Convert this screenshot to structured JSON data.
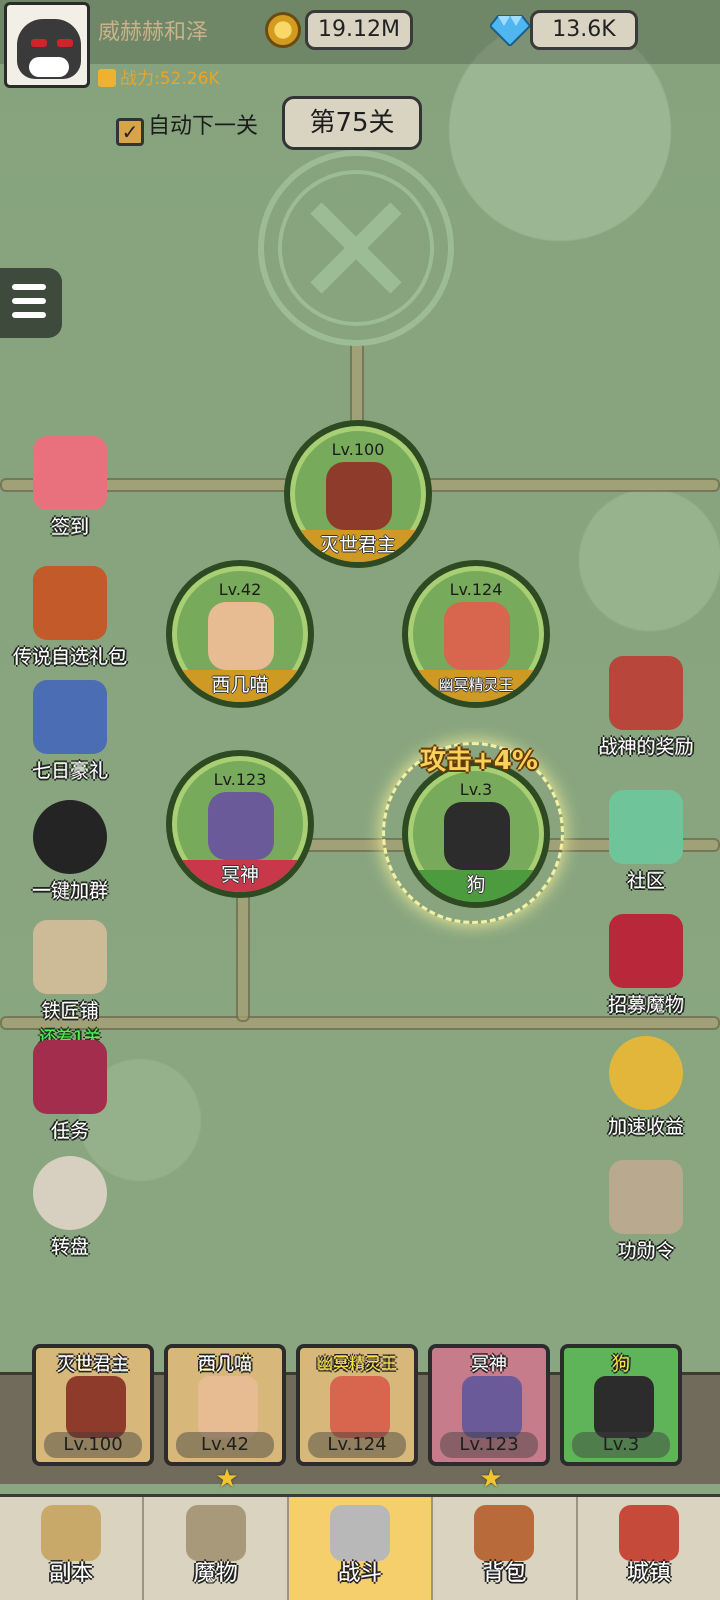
{
  "header": {
    "player_name": "威赫赫和泽",
    "power_label": "战力:52.26K",
    "coins": "19.12M",
    "gems": "13.6K"
  },
  "stage_controls": {
    "auto_next_label": "自动下一关",
    "auto_next_checked": true,
    "stage_label": "第75关"
  },
  "left_menu": [
    {
      "label": "签到",
      "sub": ""
    },
    {
      "label": "传说自选礼包",
      "sub": ""
    },
    {
      "label": "七日豪礼",
      "sub": ""
    },
    {
      "label": "一键加群",
      "sub": ""
    },
    {
      "label": "铁匠铺",
      "sub": "还差1关"
    },
    {
      "label": "任务",
      "sub": ""
    },
    {
      "label": "转盘",
      "sub": ""
    }
  ],
  "right_menu": [
    {
      "label": "战神的奖励"
    },
    {
      "label": "社区"
    },
    {
      "label": "招募魔物"
    },
    {
      "label": "加速收益"
    },
    {
      "label": "功勋令"
    }
  ],
  "heroes_on_field": [
    {
      "name": "灭世君主",
      "level": "Lv.100",
      "plate": "gold"
    },
    {
      "name": "西几喵",
      "level": "Lv.42",
      "plate": "gold"
    },
    {
      "name": "幽冥精灵王",
      "level": "Lv.124",
      "plate": "gold"
    },
    {
      "name": "冥神",
      "level": "Lv.123",
      "plate": "red"
    },
    {
      "name": "狗",
      "level": "Lv.3",
      "plate": "green"
    }
  ],
  "buff_text": "攻击+4%",
  "team": [
    {
      "name": "灭世君主",
      "level": "Lv.100",
      "starred": false
    },
    {
      "name": "西几喵",
      "level": "Lv.42",
      "starred": true
    },
    {
      "name": "幽冥精灵王",
      "level": "Lv.124",
      "starred": false
    },
    {
      "name": "冥神",
      "level": "Lv.123",
      "starred": true
    },
    {
      "name": "狗",
      "level": "Lv.3",
      "starred": false
    }
  ],
  "bottom_nav": [
    {
      "label": "副本",
      "active": false
    },
    {
      "label": "魔物",
      "active": false
    },
    {
      "label": "战斗",
      "active": true
    },
    {
      "label": "背包",
      "active": false
    },
    {
      "label": "城镇",
      "active": false
    }
  ],
  "colors": {
    "map_green": "#8aa781",
    "plate_gold": "#cf9a24",
    "plate_red": "#c8384a",
    "plate_green": "#4c9b3f",
    "active_tab": "#f6cf6d",
    "buff_text": "#f5d25c"
  }
}
